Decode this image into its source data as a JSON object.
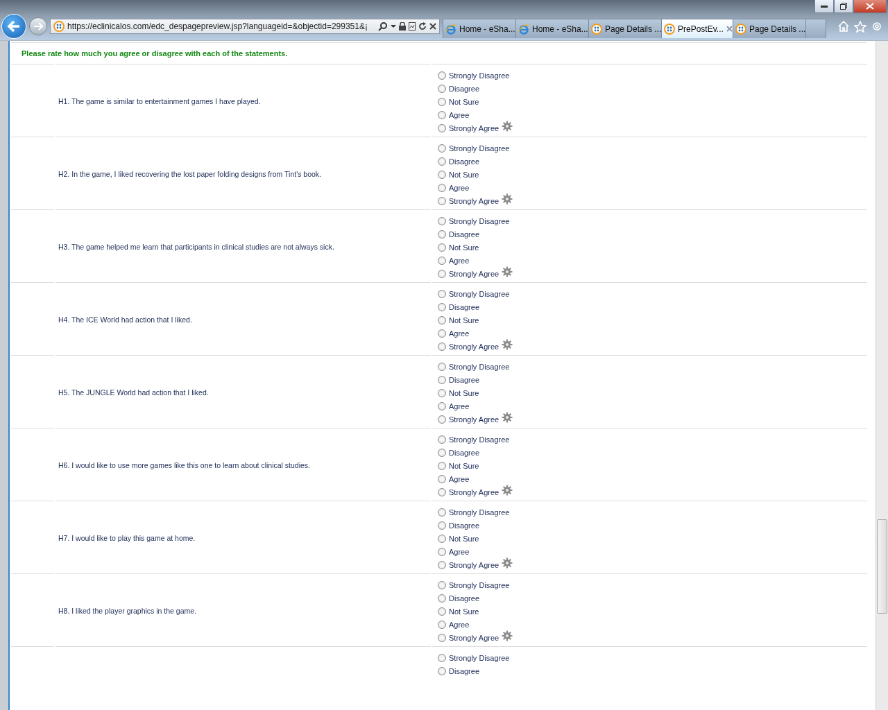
{
  "browser": {
    "address": "https://eclinicalos.com/edc_despagepreview.jsp?languageid=&objectid=299351&¡",
    "tabs": [
      {
        "label": "Home - eSha...",
        "kind": "ie",
        "selected": false
      },
      {
        "label": "Home - eSha...",
        "kind": "ie",
        "selected": false
      },
      {
        "label": "Page Details ...",
        "kind": "site",
        "selected": false
      },
      {
        "label": "PrePostEv...",
        "kind": "site",
        "selected": true
      },
      {
        "label": "Page Details ...",
        "kind": "site",
        "selected": false
      }
    ]
  },
  "instruction": "Please rate how much you agree or disagree with each of the statements.",
  "questions": [
    {
      "text": "H1. The game is similar to entertainment games I have played.",
      "options": [
        {
          "label": "Strongly Disagree",
          "selected": false
        },
        {
          "label": "Disagree",
          "selected": false
        },
        {
          "label": "Not Sure",
          "selected": false
        },
        {
          "label": "Agree",
          "selected": false
        },
        {
          "label": "Strongly Agree",
          "selected": false
        }
      ]
    },
    {
      "text": "H2. In the game, I liked recovering the lost paper folding designs from Tint's book.",
      "options": [
        {
          "label": "Strongly Disagree",
          "selected": false
        },
        {
          "label": "Disagree",
          "selected": false
        },
        {
          "label": "Not Sure",
          "selected": false
        },
        {
          "label": "Agree",
          "selected": false
        },
        {
          "label": "Strongly Agree",
          "selected": false
        }
      ]
    },
    {
      "text": "H3. The game helped me learn that participants in clinical studies are not always sick.",
      "options": [
        {
          "label": "Strongly Disagree",
          "selected": false
        },
        {
          "label": "Disagree",
          "selected": false
        },
        {
          "label": "Not Sure",
          "selected": false
        },
        {
          "label": "Agree",
          "selected": false
        },
        {
          "label": "Strongly Agree",
          "selected": false
        }
      ]
    },
    {
      "text": "H4. The ICE World had action that I liked.",
      "options": [
        {
          "label": "Strongly Disagree",
          "selected": false
        },
        {
          "label": "Disagree",
          "selected": false
        },
        {
          "label": "Not Sure",
          "selected": false
        },
        {
          "label": "Agree",
          "selected": false
        },
        {
          "label": "Strongly Agree",
          "selected": false
        }
      ]
    },
    {
      "text": "H5. The JUNGLE World had action that I liked.",
      "options": [
        {
          "label": "Strongly Disagree",
          "selected": false
        },
        {
          "label": "Disagree",
          "selected": false
        },
        {
          "label": "Not Sure",
          "selected": false
        },
        {
          "label": "Agree",
          "selected": false
        },
        {
          "label": "Strongly Agree",
          "selected": false
        }
      ]
    },
    {
      "text": "H6. I would like to use more games like this one to learn about clinical studies.",
      "options": [
        {
          "label": "Strongly Disagree",
          "selected": false
        },
        {
          "label": "Disagree",
          "selected": false
        },
        {
          "label": "Not Sure",
          "selected": false
        },
        {
          "label": "Agree",
          "selected": false
        },
        {
          "label": "Strongly Agree",
          "selected": false
        }
      ]
    },
    {
      "text": "H7. I would like to play this game at home.",
      "options": [
        {
          "label": "Strongly Disagree",
          "selected": false
        },
        {
          "label": "Disagree",
          "selected": false
        },
        {
          "label": "Not Sure",
          "selected": false
        },
        {
          "label": "Agree",
          "selected": false
        },
        {
          "label": "Strongly Agree",
          "selected": false
        }
      ]
    },
    {
      "text": "H8. I liked the player graphics in the game.",
      "options": [
        {
          "label": "Strongly Disagree",
          "selected": false
        },
        {
          "label": "Disagree",
          "selected": false
        },
        {
          "label": "Not Sure",
          "selected": false
        },
        {
          "label": "Agree",
          "selected": false
        },
        {
          "label": "Strongly Agree",
          "selected": false
        }
      ]
    },
    {
      "options": [
        {
          "label": "Strongly Disagree",
          "selected": false
        },
        {
          "label": "Disagree",
          "selected": false
        }
      ]
    }
  ]
}
